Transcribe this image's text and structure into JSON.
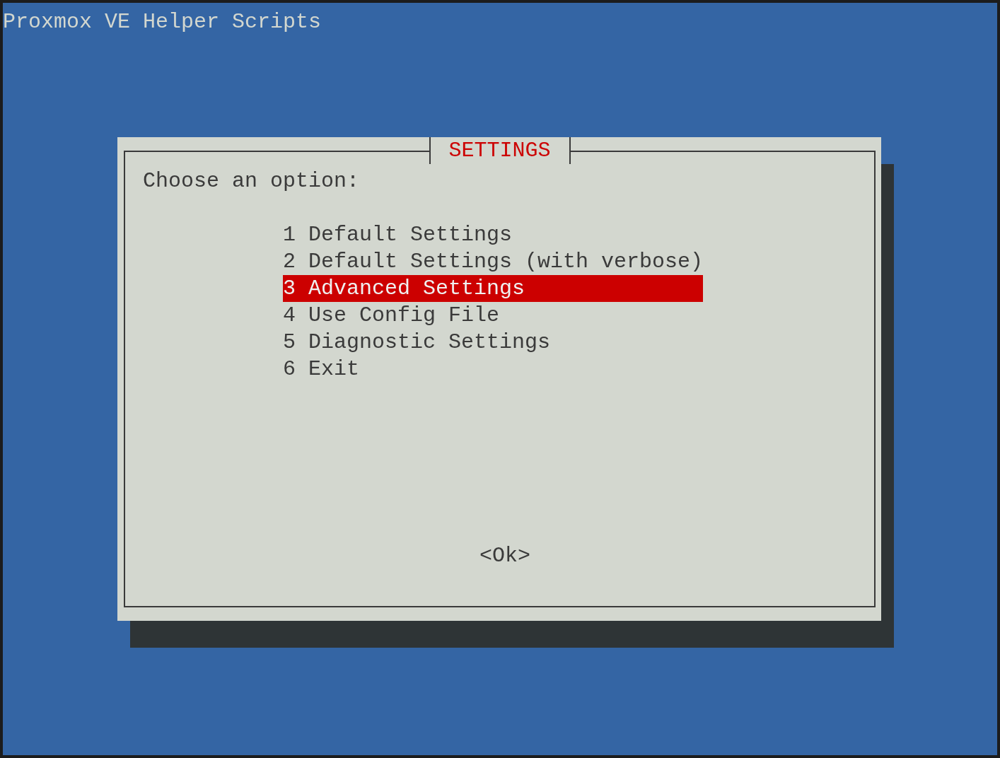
{
  "screen_title": "Proxmox VE Helper Scripts",
  "dialog": {
    "title": "SETTINGS",
    "prompt": "Choose an option:",
    "items": [
      {
        "tag": "1",
        "label": "Default Settings",
        "selected": false
      },
      {
        "tag": "2",
        "label": "Default Settings (with verbose)",
        "selected": false
      },
      {
        "tag": "3",
        "label": "Advanced Settings",
        "selected": true
      },
      {
        "tag": "4",
        "label": "Use Config File",
        "selected": false
      },
      {
        "tag": "5",
        "label": "Diagnostic Settings",
        "selected": false
      },
      {
        "tag": "6",
        "label": "Exit",
        "selected": false
      }
    ],
    "buttons": [
      "<Ok>"
    ]
  }
}
